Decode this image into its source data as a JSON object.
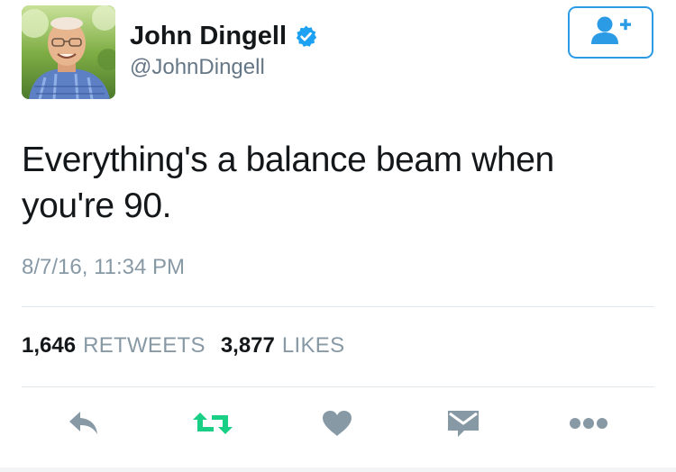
{
  "author": {
    "display_name": "John Dingell",
    "handle": "@JohnDingell",
    "verified": true,
    "avatar_icon": "profile-photo"
  },
  "follow_button": {
    "icon": "follow-user-plus-icon",
    "color": "#2b9be6"
  },
  "tweet": {
    "text": "Everything's a balance beam when you're 90.",
    "timestamp": "8/7/16, 11:34 PM"
  },
  "stats": {
    "retweets_count": "1,646",
    "retweets_label": "RETWEETS",
    "likes_count": "3,877",
    "likes_label": "LIKES"
  },
  "actions": [
    {
      "icon": "reply-icon"
    },
    {
      "icon": "retweet-icon",
      "color": "#19cf86"
    },
    {
      "icon": "like-heart-icon"
    },
    {
      "icon": "direct-message-icon"
    },
    {
      "icon": "more-options-icon"
    }
  ],
  "colors": {
    "text_primary": "#14171a",
    "text_secondary": "#8899a6",
    "accent_blue": "#1da1f2",
    "icon_gray": "#8899a6",
    "retweet_green": "#19cf86"
  }
}
